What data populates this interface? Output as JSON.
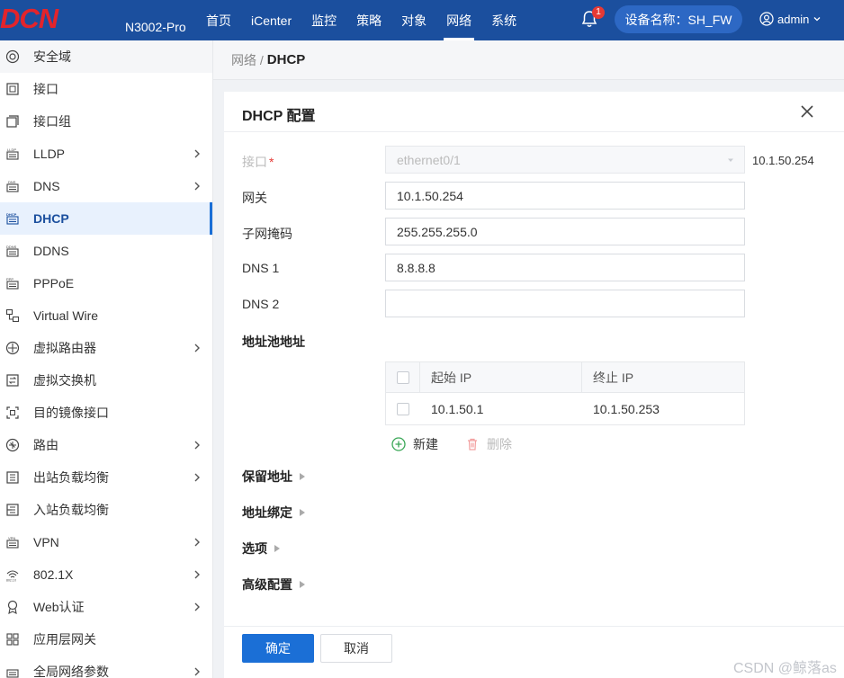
{
  "header": {
    "logo_text": "DCN",
    "model": "N3002-Pro",
    "nav": [
      "首页",
      "iCenter",
      "监控",
      "策略",
      "对象",
      "网络",
      "系统"
    ],
    "active_nav": "网络",
    "notification_count": "1",
    "device_name": "设备名称：SH_FW",
    "user": "admin"
  },
  "sidebar": {
    "items": [
      {
        "label": "安全域",
        "icon": "security-zone-icon",
        "arrow": false
      },
      {
        "label": "接口",
        "icon": "interface-icon",
        "arrow": false
      },
      {
        "label": "接口组",
        "icon": "interface-group-icon",
        "arrow": false
      },
      {
        "label": "LLDP",
        "icon": "lldp-icon",
        "arrow": true
      },
      {
        "label": "DNS",
        "icon": "dns-icon",
        "arrow": true
      },
      {
        "label": "DHCP",
        "icon": "dhcp-icon",
        "arrow": false
      },
      {
        "label": "DDNS",
        "icon": "ddns-icon",
        "arrow": false
      },
      {
        "label": "PPPoE",
        "icon": "pppoe-icon",
        "arrow": false
      },
      {
        "label": "Virtual Wire",
        "icon": "virtual-wire-icon",
        "arrow": false
      },
      {
        "label": "虚拟路由器",
        "icon": "virtual-router-icon",
        "arrow": true
      },
      {
        "label": "虚拟交换机",
        "icon": "virtual-switch-icon",
        "arrow": false
      },
      {
        "label": "目的镜像接口",
        "icon": "mirror-interface-icon",
        "arrow": false
      },
      {
        "label": "路由",
        "icon": "route-icon",
        "arrow": true
      },
      {
        "label": "出站负载均衡",
        "icon": "outbound-lb-icon",
        "arrow": true
      },
      {
        "label": "入站负载均衡",
        "icon": "inbound-lb-icon",
        "arrow": false
      },
      {
        "label": "VPN",
        "icon": "vpn-icon",
        "arrow": true
      },
      {
        "label": "802.1X",
        "icon": "wifi-8021x-icon",
        "arrow": true
      },
      {
        "label": "Web认证",
        "icon": "web-auth-icon",
        "arrow": true
      },
      {
        "label": "应用层网关",
        "icon": "app-gateway-icon",
        "arrow": false
      },
      {
        "label": "全局网络参数",
        "icon": "global-params-icon",
        "arrow": true
      }
    ],
    "active_item": "DHCP"
  },
  "breadcrumb": {
    "parent": "网络 /",
    "current": "DHCP"
  },
  "panel": {
    "title": "DHCP 配置",
    "fields": {
      "interface_label": "接口",
      "interface_required": "*",
      "interface_value": "ethernet0/1",
      "interface_ip_note": "10.1.50.254",
      "gateway_label": "网关",
      "gateway_value": "10.1.50.254",
      "netmask_label": "子网掩码",
      "netmask_value": "255.255.255.0",
      "dns1_label": "DNS 1",
      "dns1_value": "8.8.8.8",
      "dns2_label": "DNS 2",
      "dns2_value": ""
    },
    "pool": {
      "title": "地址池地址",
      "columns": [
        "起始 IP",
        "终止 IP"
      ],
      "rows": [
        [
          "10.1.50.1",
          "10.1.50.253"
        ]
      ],
      "add_label": "新建",
      "delete_label": "删除"
    },
    "sections": [
      "保留地址",
      "地址绑定",
      "选项",
      "高级配置"
    ],
    "buttons": {
      "ok": "确定",
      "cancel": "取消"
    }
  },
  "watermark": "CSDN @鲸落as",
  "colors": {
    "header_bg": "#1b4f9e",
    "accent": "#1b6fd6",
    "logo_red": "#e3242b",
    "badge_red": "#e53935"
  }
}
